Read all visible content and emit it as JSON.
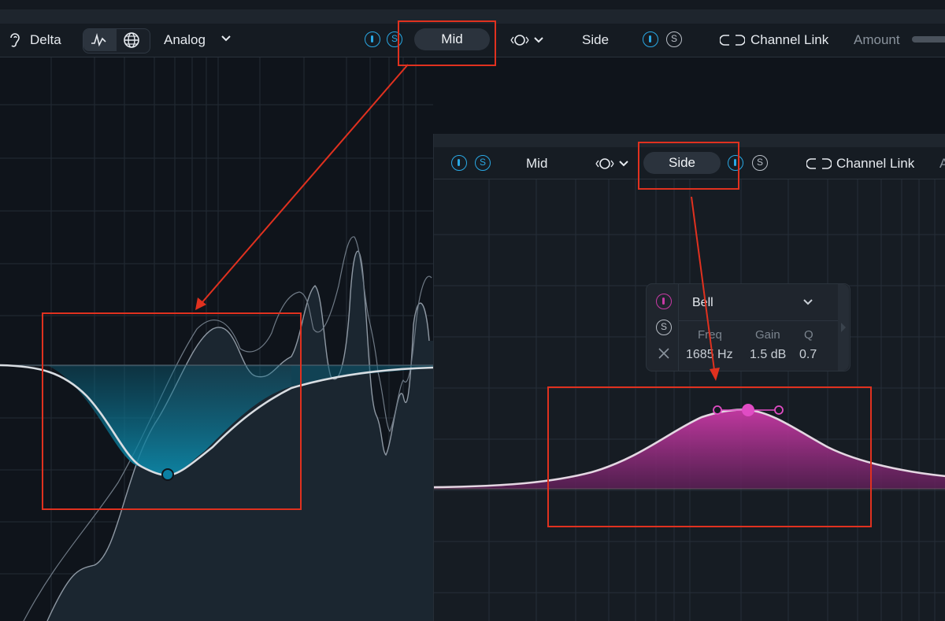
{
  "toolbar": {
    "delta_label": "Delta",
    "mode_label": "Analog",
    "mid_label": "Mid",
    "side_label": "Side",
    "channel_link_label": "Channel Link",
    "amount_label": "Amount",
    "solo_glyph": "S"
  },
  "side_panel": {
    "mid_label": "Mid",
    "side_label": "Side",
    "channel_link_label": "Channel Link",
    "amount_partial": "A",
    "solo_glyph": "S"
  },
  "band_popup": {
    "shape": "Bell",
    "freq_label": "Freq",
    "gain_label": "Gain",
    "q_label": "Q",
    "freq_value": "1685 Hz",
    "gain_value": "1.5 dB",
    "q_value": "0.7",
    "solo_glyph": "S"
  },
  "colors": {
    "background": "#0f141b",
    "accent_blue": "#2aa8e4",
    "mid_fill": "#0a6a86",
    "side_fill": "#c93aa6",
    "annotation_red": "#e0311f"
  }
}
